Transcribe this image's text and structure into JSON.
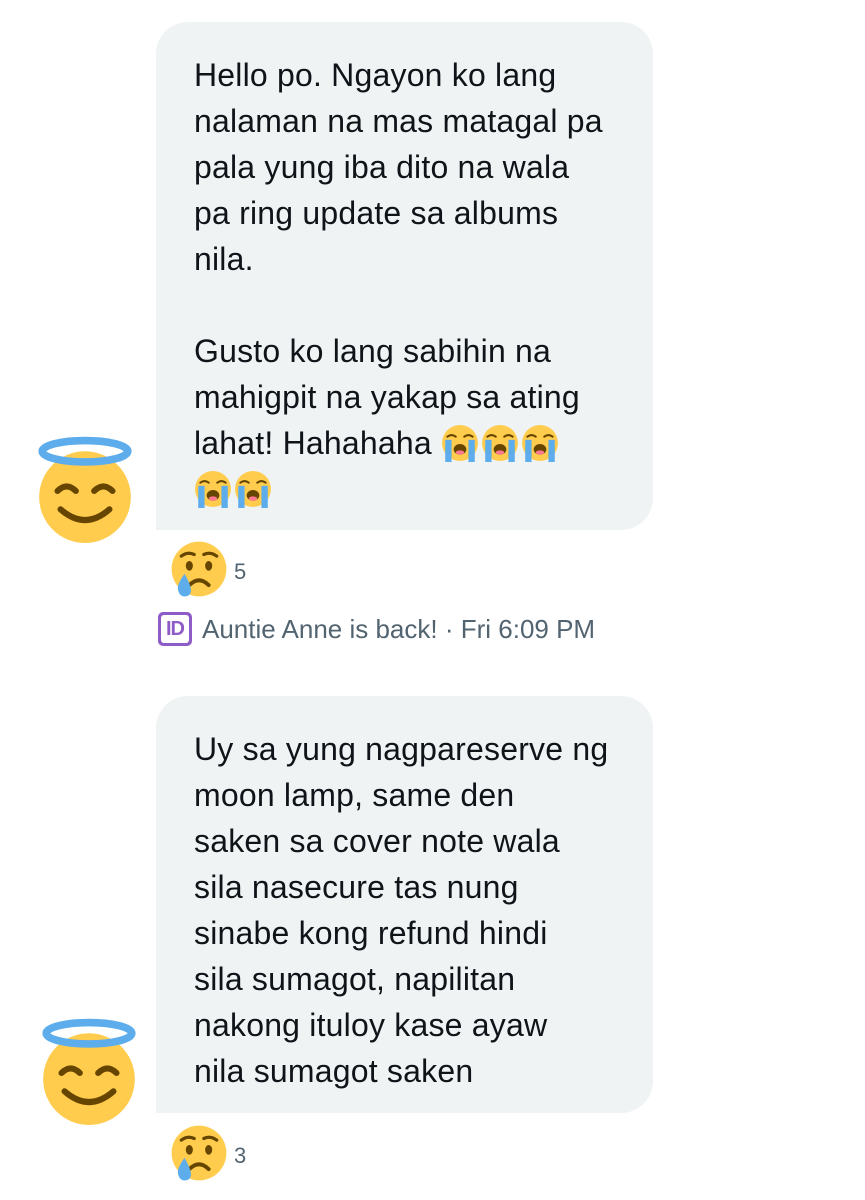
{
  "messages": [
    {
      "paragraphs": [
        "Hello po. Ngayon ko lang\nnalaman na mas matagal pa\npala yung iba dito na wala\npa ring update sa albums\nnila.",
        "Gusto ko lang sabihin na\nmahigpit na yakap sa ating\nlahat! Hahahaha "
      ],
      "trailing_emoji": "loudly-crying-face",
      "trailing_emoji_count": 5,
      "avatar_icon": "smiling-face-with-halo-icon",
      "reaction": {
        "icon": "crying-face-icon",
        "count": "5"
      }
    },
    {
      "paragraphs": [
        "Uy sa yung nagpareserve ng\nmoon lamp, same den\nsaken sa cover note wala\nsila nasecure tas nung\nsinabe kong refund hindi\nsila sumagot, napilitan\nnakong ituloy kase ayaw\nnila sumagot saken"
      ],
      "avatar_icon": "smiling-face-with-halo-icon",
      "reaction": {
        "icon": "crying-face-icon",
        "count": "3"
      }
    }
  ],
  "meta": {
    "badge": "ID",
    "sender": "Auntie Anne is back!",
    "separator": " · ",
    "timestamp": "Fri 6:09 PM"
  },
  "colors": {
    "bubble": "#eff3f4",
    "text": "#0f1419",
    "meta_text": "#536471",
    "badge": "#8e5cc6"
  }
}
